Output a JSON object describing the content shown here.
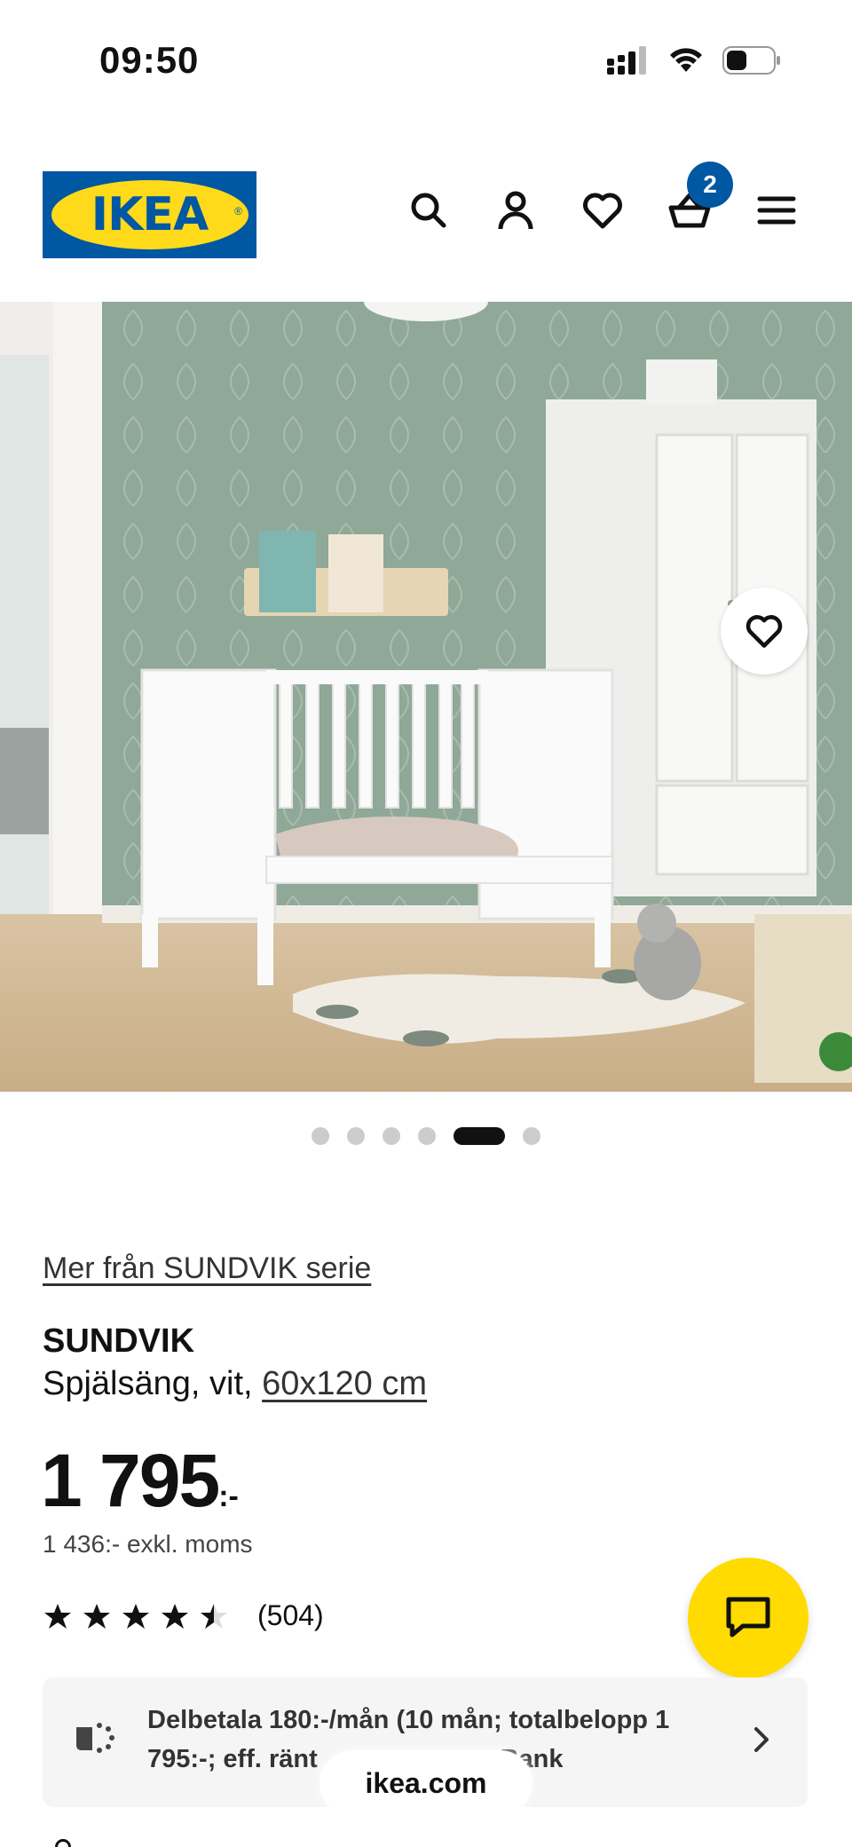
{
  "status_bar": {
    "time": "09:50"
  },
  "header": {
    "logo_text": "IKEA",
    "logo_registered": "®",
    "cart_count": "2",
    "icons": [
      "search-icon",
      "user-icon",
      "heart-icon",
      "cart-icon",
      "menu-icon"
    ]
  },
  "carousel": {
    "total": 6,
    "active_index": 4
  },
  "product": {
    "series_link": "Mer från SUNDVIK serie",
    "name": "SUNDVIK",
    "description": "Spjälsäng, vit, ",
    "size": "60x120 cm",
    "price": "1 795",
    "price_suffix": ":-",
    "price_ex_vat": "1 436:- exkl. moms",
    "rating_stars": 4.5,
    "rating_max": 5,
    "rating_count": "(504)"
  },
  "installment": {
    "text_line1": "Delbetala 180:-/mån (10 mån; totalbelopp 1",
    "text_line2": "795:-; eff. ränt",
    "text_line2_tail": "o Bank"
  },
  "browser": {
    "url": "ikea.com"
  },
  "colors": {
    "ikea_blue": "#0058a3",
    "ikea_yellow": "#ffda1a",
    "chat_yellow": "#ffdb00",
    "wall_green": "#8ba394"
  }
}
